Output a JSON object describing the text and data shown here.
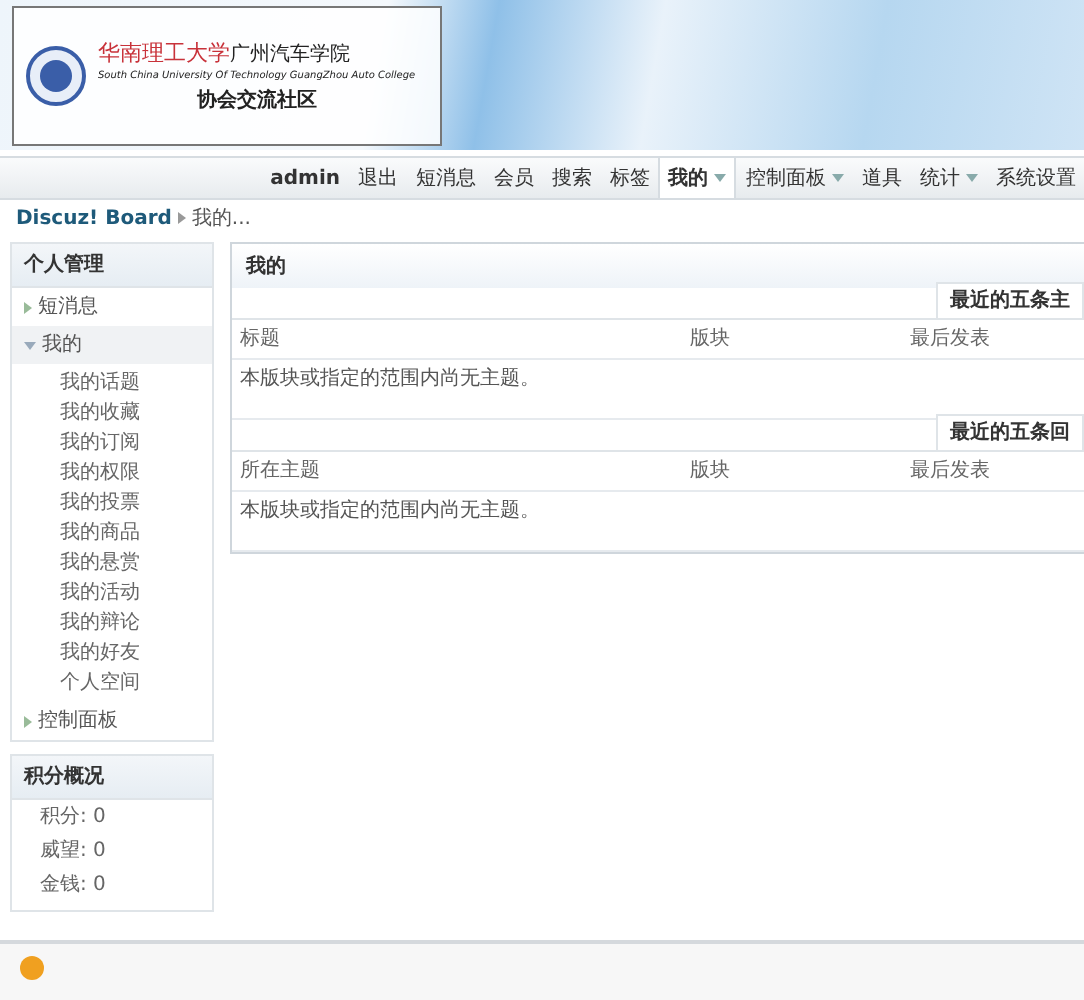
{
  "header": {
    "logo": {
      "school_name": "华南理工大学",
      "college_name": "广州汽车学院",
      "english_name": "South China University Of Technology GuangZhou Auto College",
      "community": "协会交流社区"
    }
  },
  "nav": [
    {
      "label": "admin",
      "kind": "user",
      "selected": false,
      "has_menu": false
    },
    {
      "label": "退出",
      "kind": "link",
      "selected": false,
      "has_menu": false
    },
    {
      "label": "短消息",
      "kind": "link",
      "selected": false,
      "has_menu": false
    },
    {
      "label": "会员",
      "kind": "link",
      "selected": false,
      "has_menu": false
    },
    {
      "label": "搜索",
      "kind": "link",
      "selected": false,
      "has_menu": false
    },
    {
      "label": "标签",
      "kind": "link",
      "selected": false,
      "has_menu": false
    },
    {
      "label": "我的",
      "kind": "link",
      "selected": true,
      "has_menu": true
    },
    {
      "label": "控制面板",
      "kind": "link",
      "selected": false,
      "has_menu": true
    },
    {
      "label": "道具",
      "kind": "link",
      "selected": false,
      "has_menu": false
    },
    {
      "label": "统计",
      "kind": "link",
      "selected": false,
      "has_menu": true
    },
    {
      "label": "系统设置",
      "kind": "link",
      "selected": false,
      "has_menu": false
    }
  ],
  "breadcrumb": [
    {
      "label": "Discuz! Board",
      "kind": "link"
    },
    {
      "label": "我的...",
      "kind": "current"
    }
  ],
  "sidebar": {
    "title": "个人管理",
    "items": [
      {
        "label": "短消息",
        "expanded": false
      },
      {
        "label": "我的",
        "expanded": true,
        "children": [
          {
            "label": "我的话题"
          },
          {
            "label": "我的收藏"
          },
          {
            "label": "我的订阅"
          },
          {
            "label": "我的权限"
          },
          {
            "label": "我的投票"
          },
          {
            "label": "我的商品"
          },
          {
            "label": "我的悬赏"
          },
          {
            "label": "我的活动"
          },
          {
            "label": "我的辩论"
          },
          {
            "label": "我的好友"
          },
          {
            "label": "个人空间"
          }
        ]
      },
      {
        "label": "控制面板",
        "expanded": false
      }
    ]
  },
  "credits": {
    "title": "积分概况",
    "items": [
      "积分: 0",
      "威望: 0",
      "金钱: 0"
    ]
  },
  "main": {
    "title": "我的",
    "sections": [
      {
        "tab": "最近的五条主",
        "columns": [
          "标题",
          "版块",
          "最后发表"
        ],
        "empty_text": "本版块或指定的范围内尚无主题。"
      },
      {
        "tab": "最近的五条回",
        "columns": [
          "所在主题",
          "版块",
          "最后发表"
        ],
        "empty_text": "本版块或指定的范围内尚无主题。"
      }
    ]
  }
}
